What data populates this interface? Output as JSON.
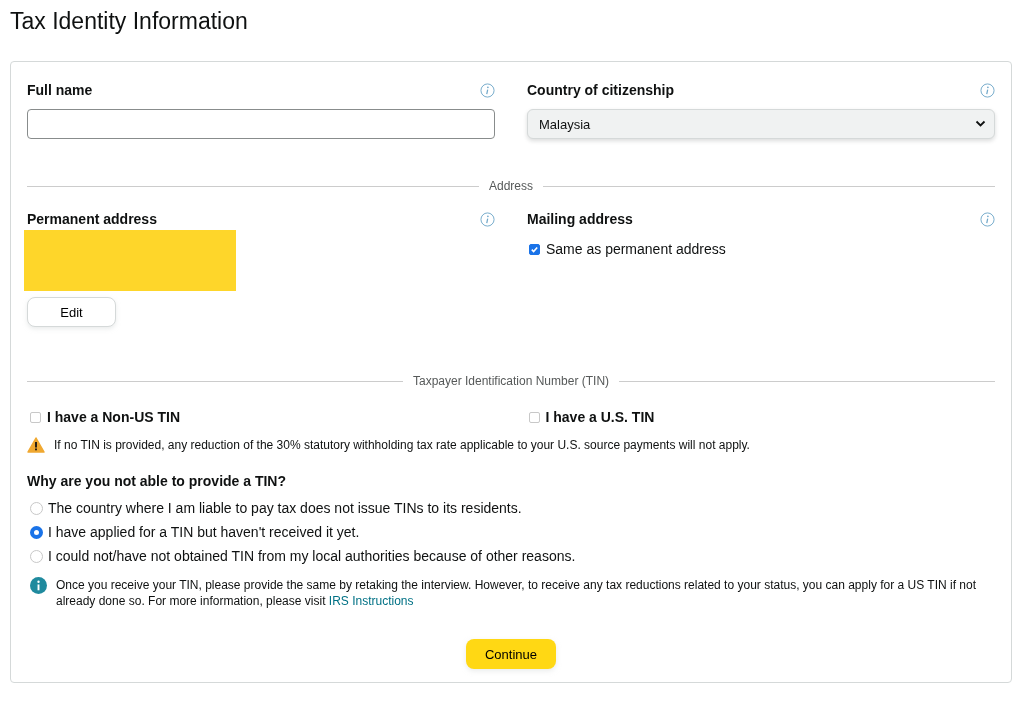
{
  "page": {
    "title": "Tax Identity Information"
  },
  "identity": {
    "full_name": {
      "label": "Full name"
    },
    "country": {
      "label": "Country of citizenship",
      "value": "Malaysia"
    }
  },
  "address_section": {
    "divider": "Address",
    "permanent": {
      "label": "Permanent address",
      "redacted": true,
      "edit_button": "Edit"
    },
    "mailing": {
      "label": "Mailing address",
      "same_as_permanent": {
        "label": "Same as permanent address",
        "checked": true
      }
    }
  },
  "tin_section": {
    "divider": "Taxpayer Identification Number (TIN)",
    "options": [
      {
        "label": "I have a Non-US TIN",
        "checked": false
      },
      {
        "label": "I have a U.S. TIN",
        "checked": false
      }
    ],
    "warning": "If no TIN is provided, any reduction of the 30% statutory withholding tax rate applicable to your U.S. source payments will not apply.",
    "question": "Why are you not able to provide a TIN?",
    "reasons": [
      {
        "label": "The country where I am liable to pay tax does not issue TINs to its residents.",
        "selected": false
      },
      {
        "label": "I have applied for a TIN but haven't received it yet.",
        "selected": true
      },
      {
        "label": "I could not/have not obtained TIN from my local authorities because of other reasons.",
        "selected": false
      }
    ],
    "info": {
      "text": "Once you receive your TIN, please provide the same by retaking the interview. However, to receive any tax reductions related to your status, you can apply for a US TIN if not already done so. For more information, please visit",
      "link": "IRS Instructions"
    }
  },
  "actions": {
    "continue_button": "Continue"
  }
}
